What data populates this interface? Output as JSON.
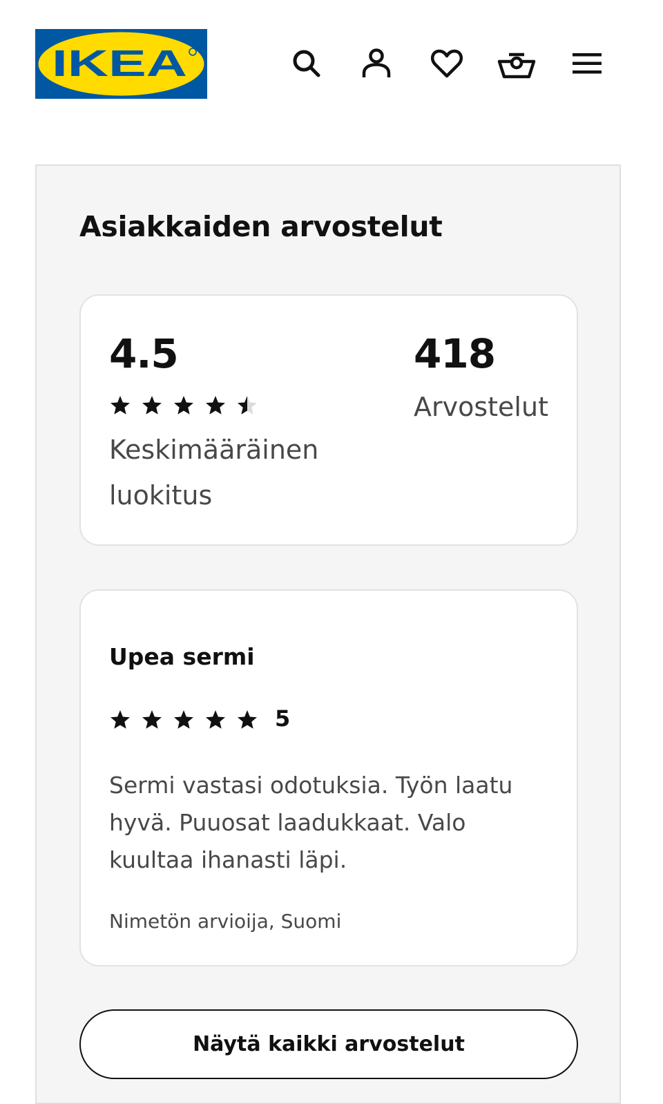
{
  "header": {
    "logo_text": "IKEA",
    "icons": [
      "search-icon",
      "user-icon",
      "heart-icon",
      "basket-icon",
      "menu-icon"
    ]
  },
  "reviews_section": {
    "title": "Asiakkaiden arvostelut",
    "average": "4.5",
    "average_stars": 4.5,
    "average_label_line1": "Keskimääräinen",
    "average_label_line2": "luokitus",
    "count": "418",
    "count_label": "Arvostelut"
  },
  "review": {
    "title": "Upea sermi",
    "rating": "5",
    "rating_stars": 5,
    "text": "Sermi vastasi odotuksia. Työn laatu hyvä. Puuosat laadukkaat. Valo kuultaa ihanasti läpi.",
    "author": "Nimetön arvioija, Suomi"
  },
  "show_all_button": "Näytä kaikki arvostelut",
  "colors": {
    "brand_blue": "#0058a3",
    "brand_yellow": "#ffdb00",
    "panel_bg": "#f5f5f5",
    "text_dark": "#111111",
    "text_gray": "#484848"
  }
}
